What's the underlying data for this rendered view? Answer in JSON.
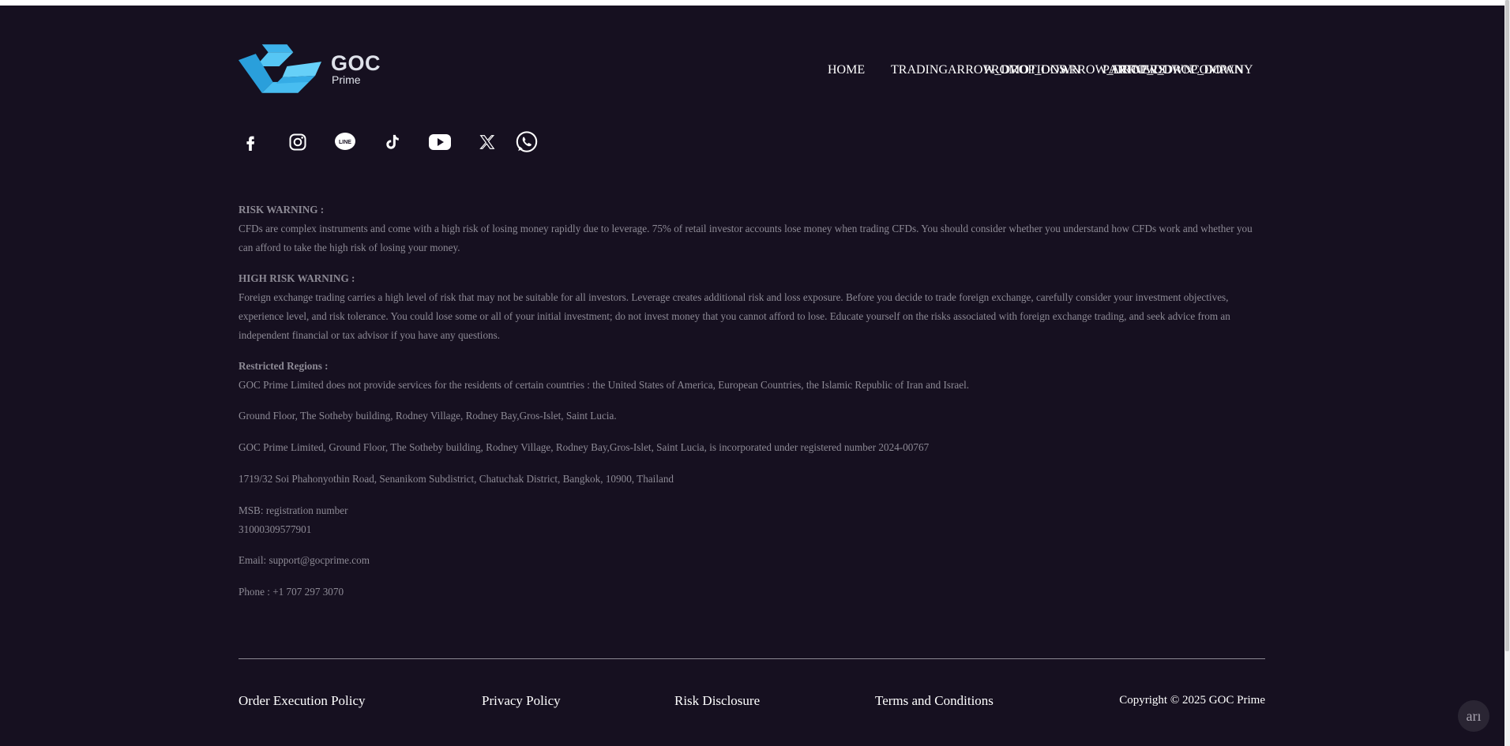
{
  "brand": {
    "name": "GOC",
    "sub": "Prime"
  },
  "nav": {
    "home": "HOME",
    "trading": "TRADING",
    "trading_arrow": "arrow_drop_down",
    "promotions": "PROMOTIONS",
    "promotions_arrow": "arrow_drop_down",
    "partners": "PARTNERS",
    "partners_arrow": "arrow_drop_down",
    "company": "COMPANY"
  },
  "social_icons": [
    "facebook-icon",
    "instagram-icon",
    "line-icon",
    "tiktok-icon",
    "youtube-icon",
    "x-icon",
    "whatsapp-icon"
  ],
  "legal": {
    "risk_warning_title": "RISK WARNING :",
    "risk_warning_text": "CFDs are complex instruments and come with a high risk of losing money rapidly due to leverage. 75% of retail investor accounts lose money when trading CFDs. You should consider whether you understand how CFDs work and whether you can afford to take the high risk of losing your money.",
    "high_risk_title": "HIGH RISK WARNING :",
    "high_risk_text": "Foreign exchange trading carries a high level of risk that may not be suitable for all investors. Leverage creates additional risk and loss exposure. Before you decide to trade foreign exchange, carefully consider your investment objectives, experience level, and risk tolerance. You could lose some or all of your initial investment; do not invest money that you cannot afford to lose. Educate yourself on the risks associated with foreign exchange trading, and seek advice from an independent financial or tax advisor if you have any questions.",
    "restricted_title": "Restricted Regions :",
    "restricted_text": "GOC Prime Limited does not provide services for the residents of certain countries : the United States of America, European Countries, the Islamic Republic of Iran and Israel.",
    "address_1": "Ground Floor, The Sotheby building, Rodney Village, Rodney Bay,Gros-Islet, Saint Lucia.",
    "incorporation": "GOC Prime Limited, Ground Floor, The Sotheby building, Rodney Village, Rodney Bay,Gros-Islet, Saint Lucia, is incorporated under registered number 2024-00767",
    "address_2": "1719/32 Soi Phahonyothin Road, Senanikom Subdistrict, Chatuchak District, Bangkok, 10900, Thailand",
    "msb_label": "MSB: registration number",
    "msb_number": "31000309577901",
    "email": "Email: support@gocprime.com",
    "phone": "Phone : +1 707 297 3070"
  },
  "footer": {
    "order_execution": "Order Execution Policy",
    "privacy": "Privacy Policy",
    "risk_disclosure": "Risk Disclosure",
    "terms": "Terms and Conditions",
    "copyright": "Copyright © 2025 GOC Prime"
  },
  "widget_label": "arı",
  "colors": {
    "background": "#161020",
    "logo_blue": "#3fb6ee",
    "text_muted": "#8d8a95"
  }
}
